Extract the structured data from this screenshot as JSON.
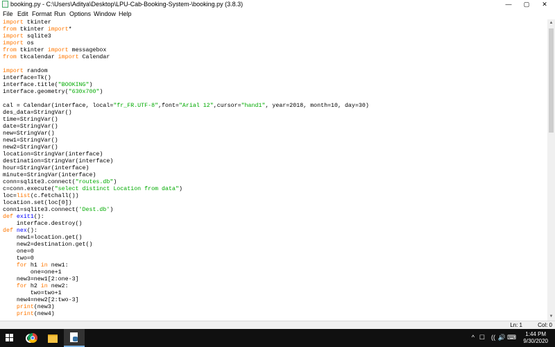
{
  "window": {
    "title": "booking.py - C:\\Users\\Aditya\\Desktop\\LPU-Cab-Booking-System-\\booking.py (3.8.3)",
    "controls": {
      "minimize": "—",
      "maximize": "▢",
      "close": "✕"
    }
  },
  "menu": [
    "File",
    "Edit",
    "Format",
    "Run",
    "Options",
    "Window",
    "Help"
  ],
  "code_lines": [
    [
      {
        "t": "import",
        "c": "kw"
      },
      {
        "t": " tkinter"
      }
    ],
    [
      {
        "t": "from",
        "c": "kw"
      },
      {
        "t": " tkinter "
      },
      {
        "t": "import",
        "c": "kw"
      },
      {
        "t": "*"
      }
    ],
    [
      {
        "t": "import",
        "c": "kw"
      },
      {
        "t": " sqlite3"
      }
    ],
    [
      {
        "t": "import",
        "c": "kw"
      },
      {
        "t": " os"
      }
    ],
    [
      {
        "t": "from",
        "c": "kw"
      },
      {
        "t": " tkinter "
      },
      {
        "t": "import",
        "c": "kw"
      },
      {
        "t": " messagebox"
      }
    ],
    [
      {
        "t": "from",
        "c": "kw"
      },
      {
        "t": " tkcalendar "
      },
      {
        "t": "import",
        "c": "kw"
      },
      {
        "t": " Calendar"
      }
    ],
    [],
    [
      {
        "t": "import",
        "c": "kw"
      },
      {
        "t": " random"
      }
    ],
    [
      {
        "t": "interface=Tk()"
      }
    ],
    [
      {
        "t": "interface.title("
      },
      {
        "t": "\"BOOKING\"",
        "c": "str"
      },
      {
        "t": ")"
      }
    ],
    [
      {
        "t": "interface.geometry("
      },
      {
        "t": "\"630x700\"",
        "c": "str"
      },
      {
        "t": ")"
      }
    ],
    [],
    [
      {
        "t": "cal = Calendar(interface, local="
      },
      {
        "t": "\"fr_FR.UTF-8\"",
        "c": "str"
      },
      {
        "t": ",font="
      },
      {
        "t": "\"Arial 12\"",
        "c": "str"
      },
      {
        "t": ",cursor="
      },
      {
        "t": "\"hand1\"",
        "c": "str"
      },
      {
        "t": ", year=2018, month=10, day=30)"
      }
    ],
    [
      {
        "t": "des_data=StringVar()"
      }
    ],
    [
      {
        "t": "time=StringVar()"
      }
    ],
    [
      {
        "t": "date=StringVar()"
      }
    ],
    [
      {
        "t": "new=StringVar()"
      }
    ],
    [
      {
        "t": "new1=StringVar()"
      }
    ],
    [
      {
        "t": "new2=StringVar()"
      }
    ],
    [
      {
        "t": "location=StringVar(interface)"
      }
    ],
    [
      {
        "t": "destination=StringVar(interface)"
      }
    ],
    [
      {
        "t": "hour=StringVar(interface)"
      }
    ],
    [
      {
        "t": "minute=StringVar(interface)"
      }
    ],
    [
      {
        "t": "conn=sqlite3.connect("
      },
      {
        "t": "\"routes.db\"",
        "c": "str"
      },
      {
        "t": ")"
      }
    ],
    [
      {
        "t": "c=conn.execute("
      },
      {
        "t": "\"select distinct Location from data\"",
        "c": "str"
      },
      {
        "t": ")"
      }
    ],
    [
      {
        "t": "loc="
      },
      {
        "t": "list",
        "c": "kw"
      },
      {
        "t": "(c.fetchall())"
      }
    ],
    [
      {
        "t": "location.set(loc[0])"
      }
    ],
    [
      {
        "t": "conn1=sqlite3.connect("
      },
      {
        "t": "'Dest.db'",
        "c": "str"
      },
      {
        "t": ")"
      }
    ],
    [
      {
        "t": "def",
        "c": "kw"
      },
      {
        "t": " "
      },
      {
        "t": "exit1",
        "c": "fn"
      },
      {
        "t": "():"
      }
    ],
    [
      {
        "t": "    interface.destroy()"
      }
    ],
    [
      {
        "t": "def",
        "c": "kw"
      },
      {
        "t": " "
      },
      {
        "t": "nex",
        "c": "fn"
      },
      {
        "t": "():"
      }
    ],
    [
      {
        "t": "    new1=location.get()"
      }
    ],
    [
      {
        "t": "    new2=destination.get()"
      }
    ],
    [
      {
        "t": "    one=0"
      }
    ],
    [
      {
        "t": "    two=0"
      }
    ],
    [
      {
        "t": "    "
      },
      {
        "t": "for",
        "c": "kw"
      },
      {
        "t": " h1 "
      },
      {
        "t": "in",
        "c": "kw"
      },
      {
        "t": " new1:"
      }
    ],
    [
      {
        "t": "        one=one+1"
      }
    ],
    [
      {
        "t": "    new3=new1[2:one-3]"
      }
    ],
    [
      {
        "t": "    "
      },
      {
        "t": "for",
        "c": "kw"
      },
      {
        "t": " h2 "
      },
      {
        "t": "in",
        "c": "kw"
      },
      {
        "t": " new2:"
      }
    ],
    [
      {
        "t": "        two=two+1"
      }
    ],
    [
      {
        "t": "    new4=new2[2:two-3]"
      }
    ],
    [
      {
        "t": "    "
      },
      {
        "t": "print",
        "c": "kw"
      },
      {
        "t": "(new3)"
      }
    ],
    [
      {
        "t": "    "
      },
      {
        "t": "print",
        "c": "kw"
      },
      {
        "t": "(new4)"
      }
    ]
  ],
  "status": {
    "line": "Ln: 1",
    "col": "Col: 0"
  },
  "taskbar": {
    "apps": [
      "start-icon",
      "search-icon",
      "task-view-icon",
      "chrome-icon",
      "file-explorer-icon",
      "python-idle-icon"
    ],
    "tray_glyphs": [
      "^",
      "☐",
      "((",
      "🔊",
      "⌨"
    ],
    "time": "1:44 PM",
    "date": "9/30/2020"
  }
}
